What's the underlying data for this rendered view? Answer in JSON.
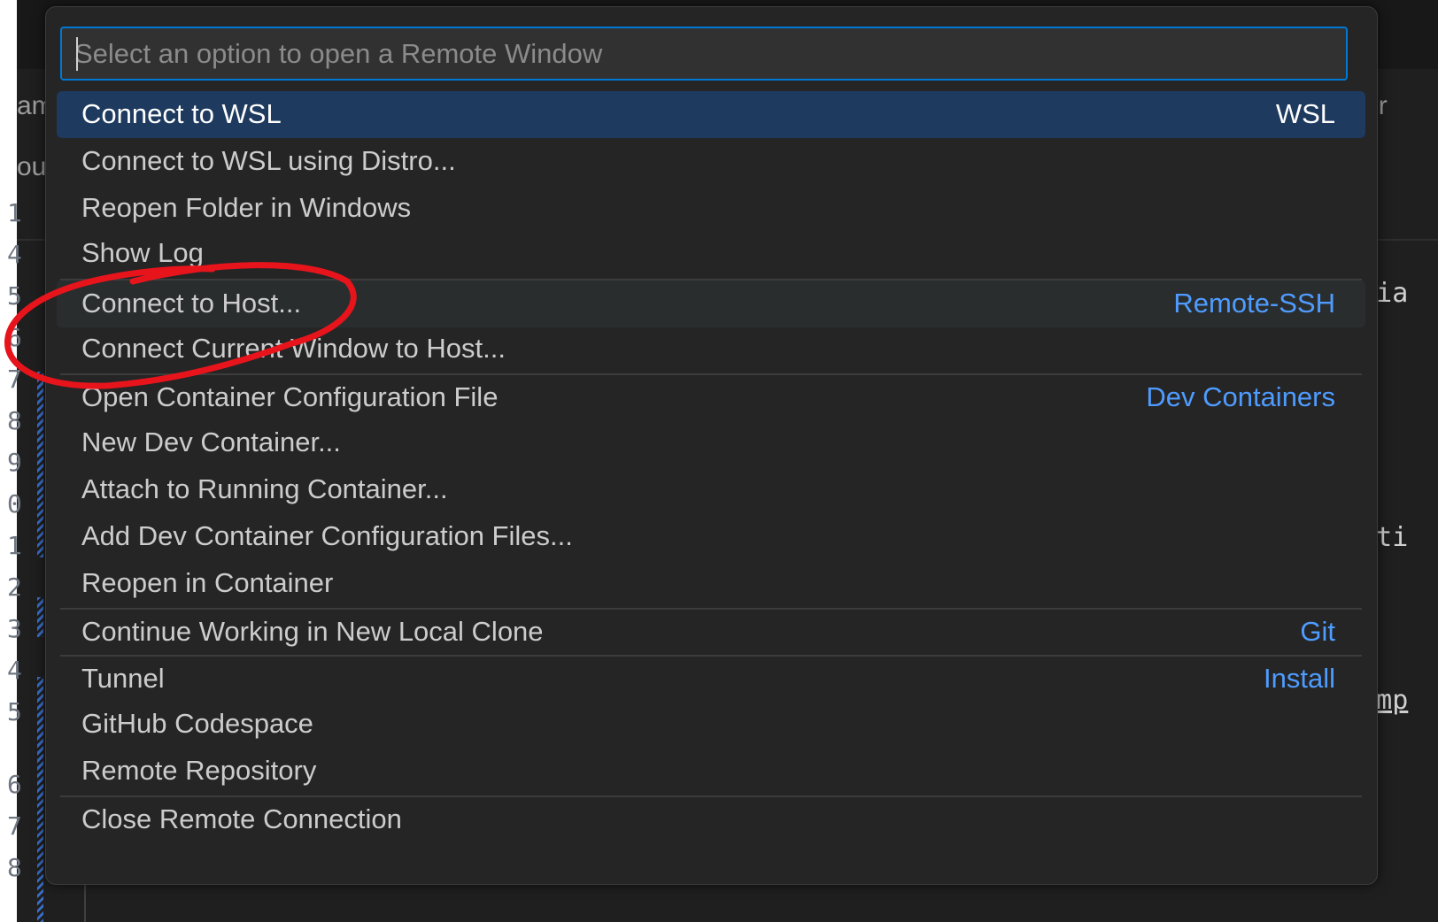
{
  "quick_pick": {
    "placeholder": "Select an option to open a Remote Window",
    "items": [
      {
        "label": "Connect to WSL",
        "badge": "WSL",
        "state": "selected"
      },
      {
        "label": "Connect to WSL using Distro...",
        "badge": ""
      },
      {
        "label": "Reopen Folder in Windows",
        "badge": ""
      },
      {
        "label": "Show Log",
        "badge": ""
      },
      {
        "label": "Connect to Host...",
        "badge": "Remote-SSH",
        "state": "hovered"
      },
      {
        "label": "Connect Current Window to Host...",
        "badge": ""
      },
      {
        "label": "Open Container Configuration File",
        "badge": "Dev Containers"
      },
      {
        "label": "New Dev Container...",
        "badge": ""
      },
      {
        "label": "Attach to Running Container...",
        "badge": ""
      },
      {
        "label": "Add Dev Container Configuration Files...",
        "badge": ""
      },
      {
        "label": "Reopen in Container",
        "badge": ""
      },
      {
        "label": "Continue Working in New Local Clone",
        "badge": "Git"
      },
      {
        "label": "Tunnel",
        "badge": "Install"
      },
      {
        "label": "GitHub Codespace",
        "badge": ""
      },
      {
        "label": "Remote Repository",
        "badge": ""
      },
      {
        "label": "Close Remote Connection",
        "badge": ""
      }
    ]
  },
  "background": {
    "left_fragments": [
      "am",
      "ou",
      "1",
      "4",
      "5",
      "6",
      "7",
      "8",
      "9",
      "0",
      "1",
      "2",
      "3",
      "4",
      "5",
      "6",
      "7",
      "8"
    ],
    "right_fragments": [
      "exter",
      "toria",
      "urati",
      "examp"
    ]
  },
  "colors": {
    "accent_blue": "#0078d4",
    "selected_row": "#1e3a5f",
    "badge_blue": "#4f9cff",
    "annotation_red": "#e8141c"
  }
}
